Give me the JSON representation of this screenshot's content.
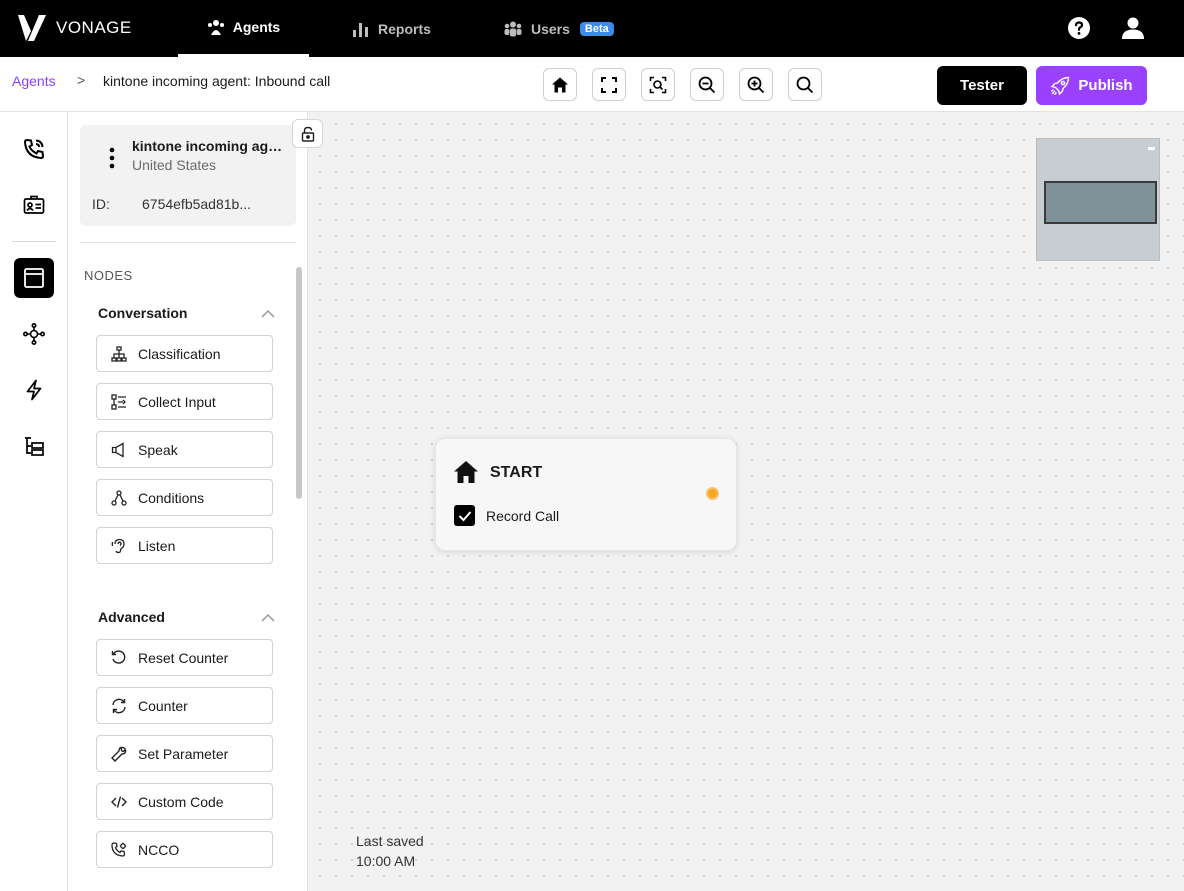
{
  "topnav": {
    "brand": "VONAGE",
    "tabs": [
      {
        "label": "Agents",
        "icon": "agents-icon",
        "active": true
      },
      {
        "label": "Reports",
        "icon": "bar-chart-icon",
        "active": false
      },
      {
        "label": "Users",
        "icon": "users-icon",
        "active": false,
        "badge": "Beta"
      }
    ],
    "right_icons": [
      "help-icon",
      "user-icon"
    ]
  },
  "breadcrumb": {
    "root": "Agents",
    "separator": ">",
    "current": "kintone incoming agent: Inbound call"
  },
  "toolbar": {
    "tools": [
      "home-icon",
      "fullscreen-icon",
      "zoom-fit-icon",
      "zoom-out-icon",
      "zoom-in-icon",
      "search-icon"
    ],
    "tester_label": "Tester",
    "publish_label": "Publish"
  },
  "rail": {
    "items": [
      "phone-call-icon",
      "id-card-icon",
      "window-icon",
      "nodes-network-icon",
      "lightning-icon",
      "tree-list-icon"
    ],
    "active": "window-icon"
  },
  "agent": {
    "name": "kintone incoming agent: Inbound call",
    "country": "United States",
    "id_label": "ID:",
    "id_value": "6754efb5ad81b..."
  },
  "panel": {
    "nodes_title": "NODES",
    "groups": [
      {
        "title": "Conversation",
        "items": [
          {
            "label": "Classification",
            "icon": "hierarchy-icon"
          },
          {
            "label": "Collect Input",
            "icon": "collect-input-icon"
          },
          {
            "label": "Speak",
            "icon": "speaker-icon"
          },
          {
            "label": "Conditions",
            "icon": "conditions-icon"
          },
          {
            "label": "Listen",
            "icon": "ear-icon"
          }
        ]
      },
      {
        "title": "Advanced",
        "items": [
          {
            "label": "Reset Counter",
            "icon": "reset-icon"
          },
          {
            "label": "Counter",
            "icon": "refresh-icon"
          },
          {
            "label": "Set Parameter",
            "icon": "wrench-icon"
          },
          {
            "label": "Custom Code",
            "icon": "code-icon"
          },
          {
            "label": "NCCO",
            "icon": "phone-settings-icon"
          }
        ]
      }
    ]
  },
  "canvas": {
    "start_node": {
      "title": "START",
      "checkbox_label": "Record Call",
      "checked": true
    },
    "last_saved_label": "Last saved",
    "last_saved_time": "10:00 AM"
  },
  "colors": {
    "accent": "#9941ff",
    "link": "#8a3ffc",
    "handle": "#f5a623",
    "beta_badge": "#3b8be8"
  }
}
